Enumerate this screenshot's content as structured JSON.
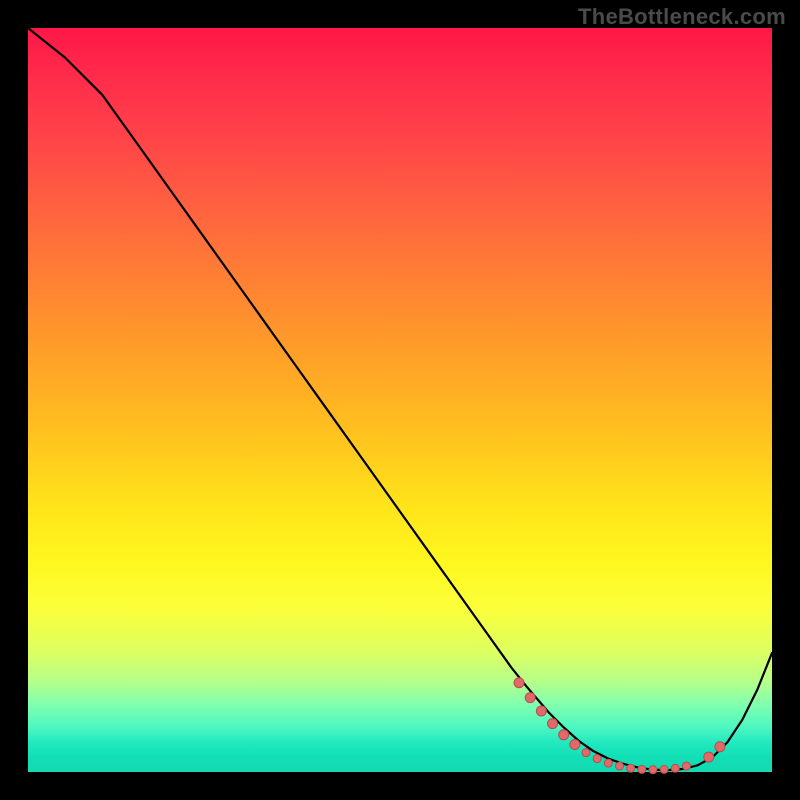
{
  "watermark": "TheBottleneck.com",
  "colors": {
    "line": "#000000",
    "marker_fill": "#e06a6a",
    "marker_stroke": "#bd4a4a",
    "frame_bg": "#000000"
  },
  "chart_data": {
    "type": "line",
    "title": "",
    "xlabel": "",
    "ylabel": "",
    "xlim": [
      0,
      100
    ],
    "ylim": [
      0,
      100
    ],
    "grid": false,
    "legend": false,
    "note": "Axes have no visible tick labels; values are estimated proportional positions (0–100). Y is plotted with 0 at bottom.",
    "series": [
      {
        "name": "curve",
        "x": [
          0,
          5,
          10,
          15,
          20,
          25,
          30,
          35,
          40,
          45,
          50,
          55,
          60,
          65,
          67,
          70,
          72,
          74,
          76,
          78,
          80,
          82,
          84,
          86,
          88,
          90,
          92,
          94,
          96,
          98,
          100
        ],
        "y": [
          100,
          96,
          91,
          84,
          77,
          70,
          63,
          56,
          49,
          42,
          35,
          28,
          21,
          14,
          11.5,
          8,
          6,
          4.2,
          2.8,
          1.8,
          1.1,
          0.6,
          0.3,
          0.25,
          0.4,
          0.9,
          2.0,
          4.0,
          7.0,
          11,
          16
        ]
      }
    ],
    "markers": [
      {
        "x": 66.0,
        "y": 12.0,
        "r": 5
      },
      {
        "x": 67.5,
        "y": 10.0,
        "r": 5
      },
      {
        "x": 69.0,
        "y": 8.2,
        "r": 5
      },
      {
        "x": 70.5,
        "y": 6.5,
        "r": 5
      },
      {
        "x": 72.0,
        "y": 5.0,
        "r": 5
      },
      {
        "x": 73.5,
        "y": 3.7,
        "r": 5
      },
      {
        "x": 75.0,
        "y": 2.6,
        "r": 4
      },
      {
        "x": 76.5,
        "y": 1.8,
        "r": 4
      },
      {
        "x": 78.0,
        "y": 1.2,
        "r": 4
      },
      {
        "x": 79.5,
        "y": 0.8,
        "r": 4
      },
      {
        "x": 81.0,
        "y": 0.5,
        "r": 4
      },
      {
        "x": 82.5,
        "y": 0.35,
        "r": 4
      },
      {
        "x": 84.0,
        "y": 0.3,
        "r": 4
      },
      {
        "x": 85.5,
        "y": 0.35,
        "r": 4
      },
      {
        "x": 87.0,
        "y": 0.5,
        "r": 4
      },
      {
        "x": 88.5,
        "y": 0.8,
        "r": 4
      },
      {
        "x": 91.5,
        "y": 2.0,
        "r": 5
      },
      {
        "x": 93.0,
        "y": 3.4,
        "r": 5
      }
    ]
  }
}
